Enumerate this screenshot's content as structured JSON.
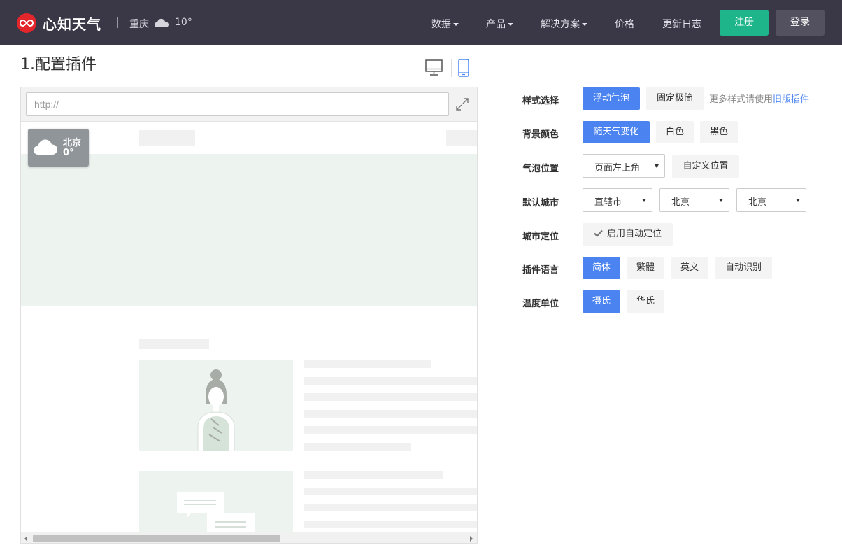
{
  "header": {
    "brand": "心知天气",
    "location": {
      "city": "重庆",
      "weather_icon": "cloud-icon",
      "temp": "10°"
    },
    "nav": [
      {
        "label": "数据",
        "dropdown": true
      },
      {
        "label": "产品",
        "dropdown": true
      },
      {
        "label": "解决方案",
        "dropdown": true
      },
      {
        "label": "价格",
        "dropdown": false
      },
      {
        "label": "更新日志",
        "dropdown": false
      }
    ],
    "register_label": "注册",
    "login_label": "登录",
    "colors": {
      "bar": "#3a3747",
      "logo": "#e3262b",
      "register": "#1fb58b",
      "login": "#53505f"
    }
  },
  "main": {
    "section_title": "1.配置插件",
    "device_toggle": {
      "desktop_icon": "desktop-icon",
      "mobile_icon": "mobile-icon",
      "active": "mobile"
    },
    "preview": {
      "url_placeholder": "http://",
      "expand_icon": "expand-icon",
      "widget": {
        "city": "北京",
        "temp": "0°",
        "icon": "cloud-icon"
      }
    }
  },
  "config": {
    "accent": "#4b84f0",
    "style": {
      "label": "样式选择",
      "options": [
        {
          "label": "浮动气泡",
          "active": true
        },
        {
          "label": "固定极简",
          "active": false
        }
      ],
      "hint": "更多样式请使用",
      "hint_link": "旧版插件"
    },
    "background": {
      "label": "背景颜色",
      "options": [
        {
          "label": "随天气变化",
          "active": true
        },
        {
          "label": "白色",
          "active": false
        },
        {
          "label": "黑色",
          "active": false
        }
      ]
    },
    "position": {
      "label": "气泡位置",
      "select_value": "页面左上角",
      "custom_label": "自定义位置"
    },
    "city": {
      "label": "默认城市",
      "selects": [
        "直辖市",
        "北京",
        "北京"
      ]
    },
    "locate": {
      "label": "城市定位",
      "option": "启用自动定位"
    },
    "language": {
      "label": "插件语言",
      "options": [
        {
          "label": "简体",
          "active": true
        },
        {
          "label": "繁體",
          "active": false
        },
        {
          "label": "英文",
          "active": false
        },
        {
          "label": "自动识别",
          "active": false
        }
      ]
    },
    "unit": {
      "label": "温度单位",
      "options": [
        {
          "label": "摄氏",
          "active": true
        },
        {
          "label": "华氏",
          "active": false
        }
      ]
    }
  }
}
